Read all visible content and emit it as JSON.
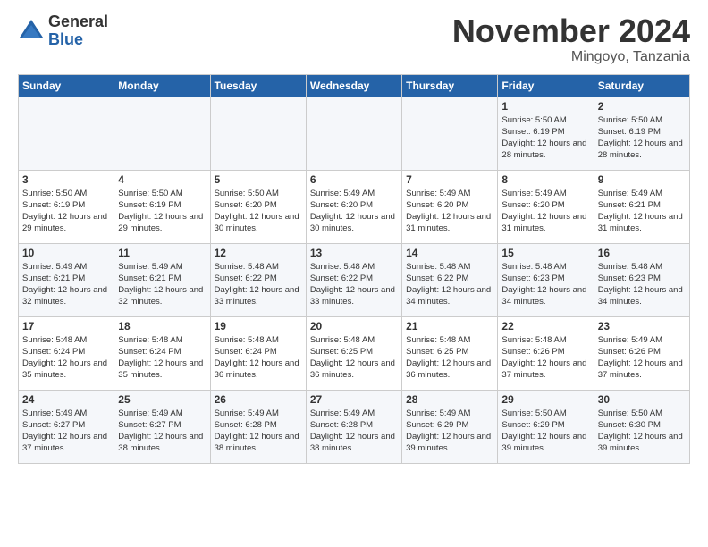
{
  "logo": {
    "general": "General",
    "blue": "Blue"
  },
  "title": "November 2024",
  "location": "Mingoyo, Tanzania",
  "headers": [
    "Sunday",
    "Monday",
    "Tuesday",
    "Wednesday",
    "Thursday",
    "Friday",
    "Saturday"
  ],
  "weeks": [
    [
      {
        "day": "",
        "info": ""
      },
      {
        "day": "",
        "info": ""
      },
      {
        "day": "",
        "info": ""
      },
      {
        "day": "",
        "info": ""
      },
      {
        "day": "",
        "info": ""
      },
      {
        "day": "1",
        "info": "Sunrise: 5:50 AM\nSunset: 6:19 PM\nDaylight: 12 hours and 28 minutes."
      },
      {
        "day": "2",
        "info": "Sunrise: 5:50 AM\nSunset: 6:19 PM\nDaylight: 12 hours and 28 minutes."
      }
    ],
    [
      {
        "day": "3",
        "info": "Sunrise: 5:50 AM\nSunset: 6:19 PM\nDaylight: 12 hours and 29 minutes."
      },
      {
        "day": "4",
        "info": "Sunrise: 5:50 AM\nSunset: 6:19 PM\nDaylight: 12 hours and 29 minutes."
      },
      {
        "day": "5",
        "info": "Sunrise: 5:50 AM\nSunset: 6:20 PM\nDaylight: 12 hours and 30 minutes."
      },
      {
        "day": "6",
        "info": "Sunrise: 5:49 AM\nSunset: 6:20 PM\nDaylight: 12 hours and 30 minutes."
      },
      {
        "day": "7",
        "info": "Sunrise: 5:49 AM\nSunset: 6:20 PM\nDaylight: 12 hours and 31 minutes."
      },
      {
        "day": "8",
        "info": "Sunrise: 5:49 AM\nSunset: 6:20 PM\nDaylight: 12 hours and 31 minutes."
      },
      {
        "day": "9",
        "info": "Sunrise: 5:49 AM\nSunset: 6:21 PM\nDaylight: 12 hours and 31 minutes."
      }
    ],
    [
      {
        "day": "10",
        "info": "Sunrise: 5:49 AM\nSunset: 6:21 PM\nDaylight: 12 hours and 32 minutes."
      },
      {
        "day": "11",
        "info": "Sunrise: 5:49 AM\nSunset: 6:21 PM\nDaylight: 12 hours and 32 minutes."
      },
      {
        "day": "12",
        "info": "Sunrise: 5:48 AM\nSunset: 6:22 PM\nDaylight: 12 hours and 33 minutes."
      },
      {
        "day": "13",
        "info": "Sunrise: 5:48 AM\nSunset: 6:22 PM\nDaylight: 12 hours and 33 minutes."
      },
      {
        "day": "14",
        "info": "Sunrise: 5:48 AM\nSunset: 6:22 PM\nDaylight: 12 hours and 34 minutes."
      },
      {
        "day": "15",
        "info": "Sunrise: 5:48 AM\nSunset: 6:23 PM\nDaylight: 12 hours and 34 minutes."
      },
      {
        "day": "16",
        "info": "Sunrise: 5:48 AM\nSunset: 6:23 PM\nDaylight: 12 hours and 34 minutes."
      }
    ],
    [
      {
        "day": "17",
        "info": "Sunrise: 5:48 AM\nSunset: 6:24 PM\nDaylight: 12 hours and 35 minutes."
      },
      {
        "day": "18",
        "info": "Sunrise: 5:48 AM\nSunset: 6:24 PM\nDaylight: 12 hours and 35 minutes."
      },
      {
        "day": "19",
        "info": "Sunrise: 5:48 AM\nSunset: 6:24 PM\nDaylight: 12 hours and 36 minutes."
      },
      {
        "day": "20",
        "info": "Sunrise: 5:48 AM\nSunset: 6:25 PM\nDaylight: 12 hours and 36 minutes."
      },
      {
        "day": "21",
        "info": "Sunrise: 5:48 AM\nSunset: 6:25 PM\nDaylight: 12 hours and 36 minutes."
      },
      {
        "day": "22",
        "info": "Sunrise: 5:48 AM\nSunset: 6:26 PM\nDaylight: 12 hours and 37 minutes."
      },
      {
        "day": "23",
        "info": "Sunrise: 5:49 AM\nSunset: 6:26 PM\nDaylight: 12 hours and 37 minutes."
      }
    ],
    [
      {
        "day": "24",
        "info": "Sunrise: 5:49 AM\nSunset: 6:27 PM\nDaylight: 12 hours and 37 minutes."
      },
      {
        "day": "25",
        "info": "Sunrise: 5:49 AM\nSunset: 6:27 PM\nDaylight: 12 hours and 38 minutes."
      },
      {
        "day": "26",
        "info": "Sunrise: 5:49 AM\nSunset: 6:28 PM\nDaylight: 12 hours and 38 minutes."
      },
      {
        "day": "27",
        "info": "Sunrise: 5:49 AM\nSunset: 6:28 PM\nDaylight: 12 hours and 38 minutes."
      },
      {
        "day": "28",
        "info": "Sunrise: 5:49 AM\nSunset: 6:29 PM\nDaylight: 12 hours and 39 minutes."
      },
      {
        "day": "29",
        "info": "Sunrise: 5:50 AM\nSunset: 6:29 PM\nDaylight: 12 hours and 39 minutes."
      },
      {
        "day": "30",
        "info": "Sunrise: 5:50 AM\nSunset: 6:30 PM\nDaylight: 12 hours and 39 minutes."
      }
    ]
  ]
}
